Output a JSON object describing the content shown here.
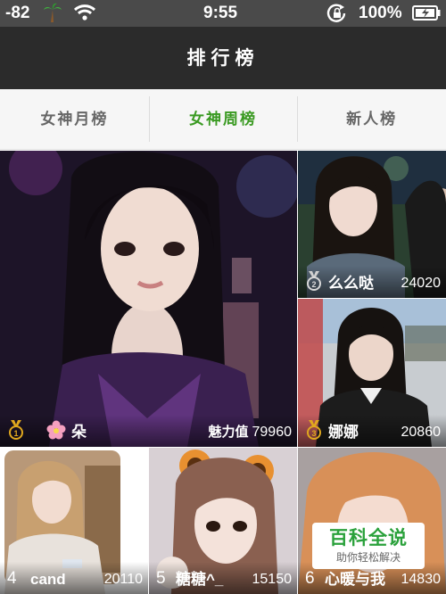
{
  "status_bar": {
    "signal": "-82",
    "time": "9:55",
    "battery_percent": "100%"
  },
  "header": {
    "title": "排行榜"
  },
  "tabs": [
    {
      "label": "女神月榜",
      "active": false
    },
    {
      "label": "女神周榜",
      "active": true
    },
    {
      "label": "新人榜",
      "active": false
    }
  ],
  "rankings": [
    {
      "rank": "1",
      "name": "朵",
      "score_label": "魅力值",
      "score": "79960"
    },
    {
      "rank": "2",
      "name": "么么哒",
      "score": "24020"
    },
    {
      "rank": "3",
      "name": "娜娜",
      "score": "20860"
    },
    {
      "rank": "4",
      "name": "cand",
      "score": "20110"
    },
    {
      "rank": "5",
      "name": "糖糖^_",
      "score": "15150"
    },
    {
      "rank": "6",
      "name": "心暖与我",
      "score": "14830"
    }
  ],
  "watermark": {
    "title": "百科全说",
    "subtitle": "助你轻松解决"
  },
  "colors": {
    "accent": "#3a9a22",
    "medal": "#e0a81e",
    "title_bar": "#2b2b2b"
  }
}
